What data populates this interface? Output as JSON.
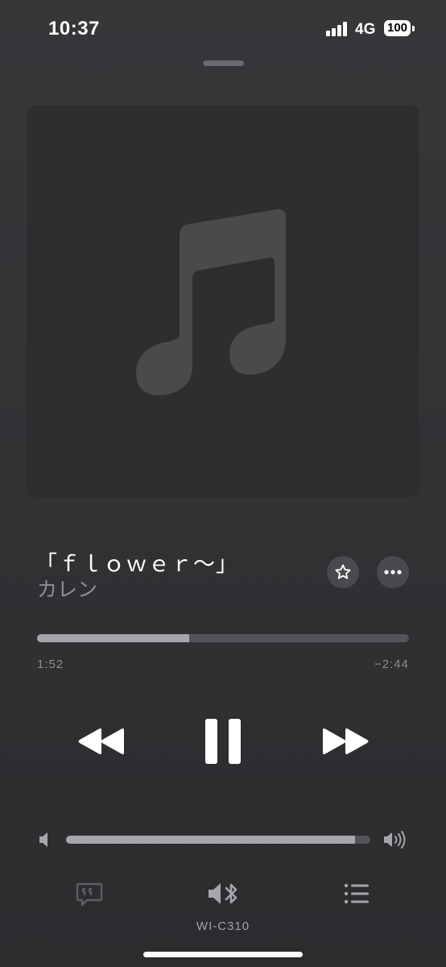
{
  "status_bar": {
    "time": "10:37",
    "network": "4G",
    "battery": "100"
  },
  "track": {
    "title": "「ｆｌｏｗｅｒ～」",
    "artist": "カレン"
  },
  "playback": {
    "elapsed": "1:52",
    "remaining": "−2:44",
    "progress_fraction": 0.41
  },
  "volume": {
    "level_fraction": 0.95
  },
  "output_device": {
    "name": "WI-C310"
  },
  "icons": {
    "artwork_placeholder": "music-note-icon",
    "favorite": "star-icon",
    "more": "ellipsis-icon",
    "rewind": "rewind-icon",
    "pause": "pause-icon",
    "forward": "fast-forward-icon",
    "volume_low": "speaker-low-icon",
    "volume_high": "speaker-high-icon",
    "lyrics": "lyrics-bubble-icon",
    "output": "bluetooth-speaker-icon",
    "queue": "list-icon"
  },
  "colors": {
    "background": "#333336",
    "accent": "#ffffff",
    "secondary_text": "#8e8e93"
  }
}
